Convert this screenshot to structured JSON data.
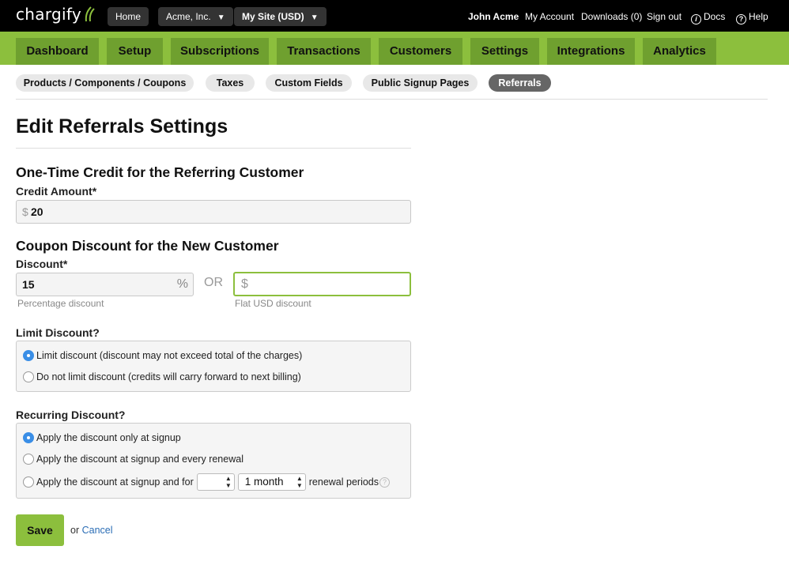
{
  "topbar": {
    "logo": "chargify",
    "home": "Home",
    "org": "Acme, Inc.",
    "site": "My Site (USD)",
    "user": "John Acme",
    "my_account": "My Account",
    "downloads": "Downloads (0)",
    "sign_out": "Sign out",
    "docs": "Docs",
    "help": "Help"
  },
  "main_nav": [
    "Dashboard",
    "Setup",
    "Subscriptions",
    "Transactions",
    "Customers",
    "Settings",
    "Integrations",
    "Analytics"
  ],
  "sub_nav": {
    "items": [
      "Products / Components / Coupons",
      "Taxes",
      "Custom Fields",
      "Public Signup Pages",
      "Referrals"
    ],
    "active": "Referrals"
  },
  "page_title": "Edit Referrals Settings",
  "credit": {
    "heading": "One-Time Credit for the Referring Customer",
    "label": "Credit Amount*",
    "prefix": "$",
    "value": "20"
  },
  "coupon": {
    "heading": "Coupon Discount for the New Customer",
    "label": "Discount*",
    "percent_value": "15",
    "percent_suffix": "%",
    "percent_help": "Percentage discount",
    "or": "OR",
    "flat_prefix": "$",
    "flat_value": "",
    "flat_help": "Flat USD discount"
  },
  "limit": {
    "label": "Limit Discount?",
    "options": [
      {
        "label": "Limit discount (discount may not exceed total of the charges)",
        "checked": true
      },
      {
        "label": "Do not limit discount (credits will carry forward to next billing)",
        "checked": false
      }
    ]
  },
  "recurring": {
    "label": "Recurring Discount?",
    "options": [
      {
        "label": "Apply the discount only at signup",
        "checked": true
      },
      {
        "label": "Apply the discount at signup and every renewal",
        "checked": false
      },
      {
        "label": "Apply the discount at signup and for",
        "checked": false
      }
    ],
    "count_value": "",
    "period_value": "1 month",
    "renewal_suffix": "renewal periods"
  },
  "actions": {
    "save": "Save",
    "or": "or",
    "cancel": "Cancel"
  },
  "colors": {
    "brand_green": "#8cbf3d",
    "tab_green": "#6fa02f",
    "link_blue": "#2a6db5",
    "radio_blue": "#3a8ee6"
  }
}
